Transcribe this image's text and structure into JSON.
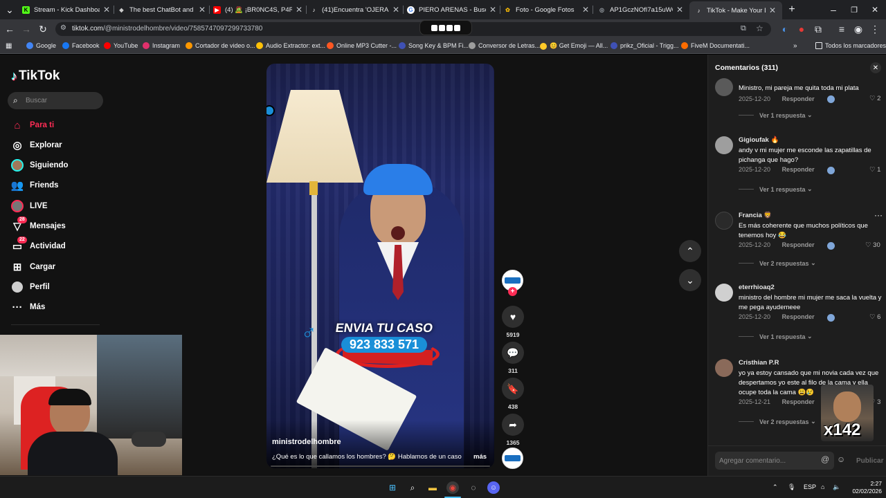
{
  "browser": {
    "tabs": [
      {
        "title": "Stream - Kick Dashboard",
        "fav_color": "#53fc18",
        "fav_glyph": "K"
      },
      {
        "title": "The best ChatBot and Wi",
        "fav_color": "#cccccc",
        "fav_glyph": "◆"
      },
      {
        "title": "(4) 🧟 ¡BR0NC4S, P4R",
        "fav_color": "#ff0000",
        "fav_glyph": "▶"
      },
      {
        "title": "(41)Encuentra 'OJERAS AI",
        "fav_color": "#ffffff",
        "fav_glyph": "♪"
      },
      {
        "title": "PIERO ARENAS - Buscar c",
        "fav_color": "#4285f4",
        "fav_glyph": "G"
      },
      {
        "title": "Foto - Google Fotos",
        "fav_color": "#fbbc04",
        "fav_glyph": "✿"
      },
      {
        "title": "AP1GczNOfI7a15uWQIr7",
        "fav_color": "#9aa0a6",
        "fav_glyph": "◎"
      },
      {
        "title": "TikTok - Make Your Day",
        "fav_color": "#ffffff",
        "fav_glyph": "♪"
      }
    ],
    "url_host": "tiktok.com",
    "url_path": "/@ministrodelhombre/video/7585747097299733780",
    "bookmarks": [
      {
        "label": "Google",
        "color": "#4285f4"
      },
      {
        "label": "Facebook",
        "color": "#1877f2"
      },
      {
        "label": "YouTube",
        "color": "#ff0000"
      },
      {
        "label": "Instagram",
        "color": "#e1306c"
      },
      {
        "label": "Cortador de video o...",
        "color": "#ff9800"
      },
      {
        "label": "Audio Extractor: ext...",
        "color": "#ffc107"
      },
      {
        "label": "Online MP3 Cutter -...",
        "color": "#ff5722"
      },
      {
        "label": "Song Key & BPM Fi...",
        "color": "#3f51b5"
      },
      {
        "label": "Conversor de Letras...",
        "color": "#9e9e9e"
      },
      {
        "label": "😊 Get Emoji — All...",
        "color": "#ffca28"
      },
      {
        "label": "prikz_Oficial - Trigg...",
        "color": "#3f51b5"
      },
      {
        "label": "FiveM Documentati...",
        "color": "#ff6d00"
      }
    ],
    "all_bookmarks": "Todos los marcadores"
  },
  "tiktok": {
    "logo": "TikTok",
    "search_placeholder": "Buscar",
    "nav": [
      {
        "label": "Para ti",
        "icon": "home-icon",
        "active": true
      },
      {
        "label": "Explorar",
        "icon": "compass-icon"
      },
      {
        "label": "Siguiendo",
        "icon": "following-avatar-icon"
      },
      {
        "label": "Friends",
        "icon": "friends-icon"
      },
      {
        "label": "LIVE",
        "icon": "live-icon"
      },
      {
        "label": "Mensajes",
        "icon": "messages-icon",
        "badge": "28"
      },
      {
        "label": "Actividad",
        "icon": "activity-icon",
        "badge": "22"
      },
      {
        "label": "Cargar",
        "icon": "upload-icon"
      },
      {
        "label": "Perfil",
        "icon": "profile-icon"
      },
      {
        "label": "Más",
        "icon": "more-icon"
      }
    ],
    "video": {
      "author": "ministrodelhombre",
      "caption": "¿Qué es lo que callamos los hombres? 🤔 Hablamos de un caso",
      "more": "más",
      "overlay_line1": "ENVIA TU CASO",
      "overlay_line2": "923 833 571"
    },
    "actions": {
      "likes": "5919",
      "comments": "311",
      "saves": "438",
      "shares": "1365"
    },
    "comments_panel": {
      "title": "Comentarios (311)",
      "input_placeholder": "Agregar comentario...",
      "publish": "Publicar",
      "reply_label": "Responder",
      "sticker_text": "x142",
      "items": [
        {
          "user": "",
          "text": "Ministro, mi pareja me quita toda mi plata",
          "date": "2025-12-20",
          "likes": "2",
          "view": "Ver 1 respuesta",
          "avatar": "#5a5a5a"
        },
        {
          "user": "Gigioufak 🔥",
          "text": "andy v mi mujer me esconde las zapatillas de pichanga que hago?",
          "date": "2025-12-20",
          "likes": "1",
          "view": "Ver 1 respuesta",
          "avatar": "#9e9e9e"
        },
        {
          "user": "Francia 🦁",
          "text": "Es más coherente que muchos políticos que tenemos hoy 😂",
          "date": "2025-12-20",
          "likes": "30",
          "view": "Ver 2 respuestas",
          "avatar": "#2a2a2a"
        },
        {
          "user": "eterrhioaq2",
          "text": "ministro del hombre mi mujer me saca la vuelta y me pega ayudemeee",
          "date": "2025-12-20",
          "likes": "6",
          "view": "Ver 1 respuesta",
          "avatar": "#d0d0d0"
        },
        {
          "user": "Cristhian P.R",
          "text": "yo ya estoy cansado que mi novia cada vez que despertamos yo este al filo de la cama y ella ocupe toda la cama 😩😢",
          "date": "2025-12-21",
          "likes": "3",
          "view": "Ver 2 respuestas",
          "avatar": "#8a6a5a"
        }
      ]
    }
  },
  "taskbar": {
    "language": "ESP",
    "time": "2:27",
    "date": "02/02/2026"
  }
}
